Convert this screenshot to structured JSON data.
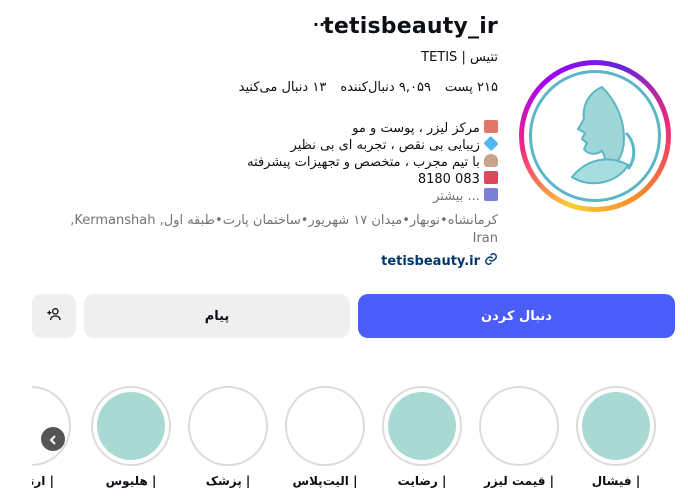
{
  "profile": {
    "username": "tetisbeauty_ir",
    "more_label": "···",
    "full_name": "تتیس | TETIS",
    "stats": {
      "posts": "۲۱۵ پست",
      "followers": "۹,۰۵۹ دنبال‌کننده",
      "following": "۱۳ دنبال می‌کنید"
    },
    "bio": [
      "مرکز لیزر ، پوست و مو",
      "زیبایی بی نقص ، تجربه ای بی نظیر",
      "با تیم مجرب ، متخصص و تجهیزات پیشرفته",
      "8180 083",
      "... بیشتر"
    ],
    "address_line1": "کرمانشاه•نوبهار•میدان ۱۷ شهریور•ساختمان پارت•طبقه اول, Kermanshah,",
    "address_line2": "Iran",
    "website": "tetisbeauty.ir"
  },
  "actions": {
    "follow_label": "دنبال کردن",
    "message_label": "پیام"
  },
  "highlights": [
    {
      "label": "| فیشال",
      "fill": "#a8d9d2"
    },
    {
      "label": "| قیمت لیزر",
      "fill": "#ffffff"
    },
    {
      "label": "| رضایت",
      "fill": "#a8d9d2"
    },
    {
      "label": "| الیت‌پلاس",
      "fill": "#ffffff"
    },
    {
      "label": "| پزشک",
      "fill": "#ffffff"
    },
    {
      "label": "| هلیوس",
      "fill": "#a8d9d2"
    },
    {
      "label": "| ارتباط",
      "fill": "#ffffff"
    }
  ],
  "colors": {
    "accent": "#4a5df9",
    "link": "#00376b",
    "secondary_text": "#737373",
    "brand_teal": "#5bb7c6"
  }
}
